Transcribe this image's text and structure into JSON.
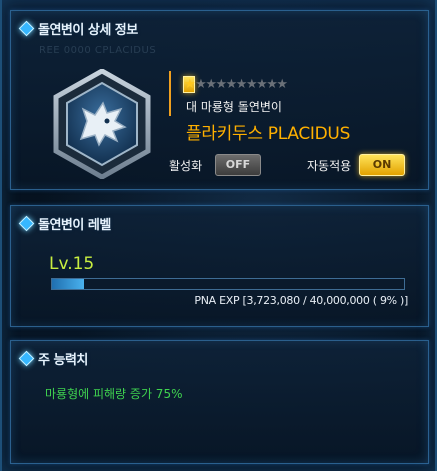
{
  "profile": {
    "title": "돌연변이 상세 정보",
    "ghost_text": "REE 0000 CPLACIDUS",
    "stars": {
      "filled": 1,
      "total": 10
    },
    "rank": "대 마룡형 돌연변이",
    "name": "플라키두스 PLACIDUS",
    "emblem_icon": "dragon-head-icon",
    "activate_label": "활성화",
    "activate_value": "OFF",
    "auto_apply_label": "자동적용",
    "auto_apply_value": "ON"
  },
  "level": {
    "title": "돌연변이 레벨",
    "value": "Lv.15",
    "exp_text": "PNA EXP [3,723,080 / 40,000,000 ( 9% )]",
    "exp_progress": 0.09
  },
  "stats": {
    "title": "주 능력치",
    "effect": "마룡형에 피해량 증가 75%"
  },
  "colors": {
    "accent": "#36b7ff",
    "gold": "#ffb000",
    "level": "#c8ee40",
    "stat": "#3fd24f"
  }
}
